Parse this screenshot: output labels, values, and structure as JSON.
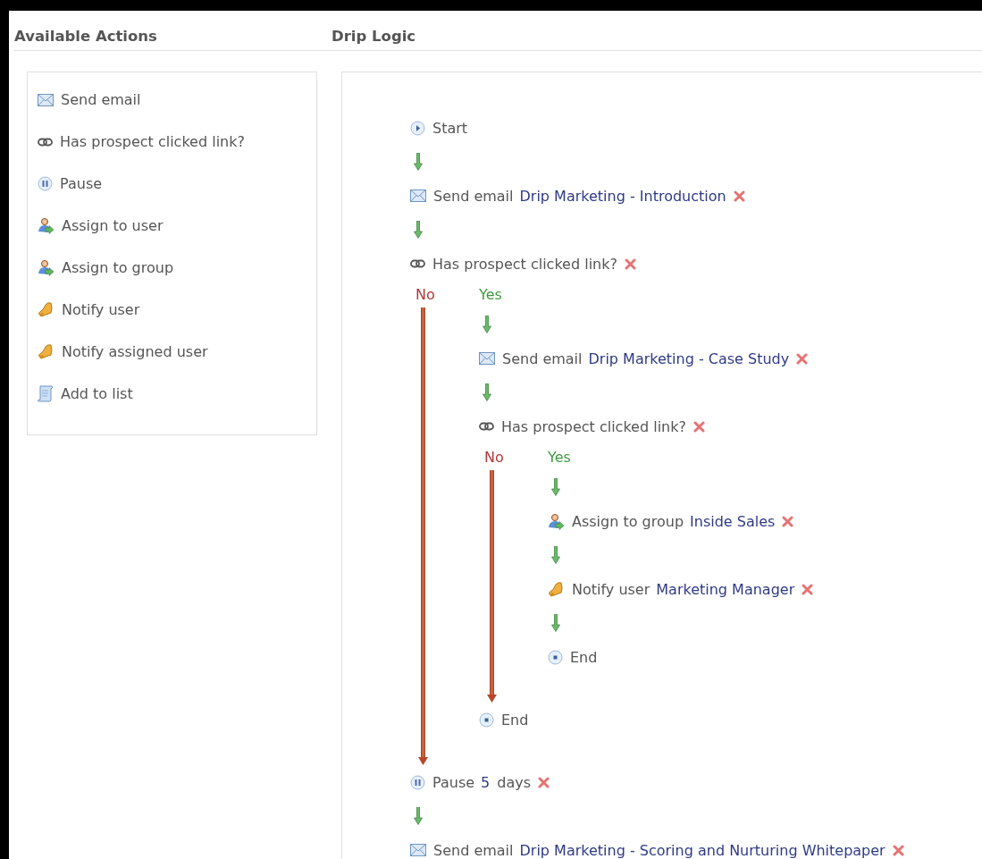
{
  "headers": {
    "actions": "Available Actions",
    "logic": "Drip Logic"
  },
  "actions": [
    {
      "kind": "email",
      "label": "Send email"
    },
    {
      "kind": "condition",
      "label": "Has prospect clicked link?"
    },
    {
      "kind": "pause",
      "label": "Pause"
    },
    {
      "kind": "assign",
      "label": "Assign to user"
    },
    {
      "kind": "assign",
      "label": "Assign to group"
    },
    {
      "kind": "notify",
      "label": "Notify user"
    },
    {
      "kind": "notify",
      "label": "Notify assigned user"
    },
    {
      "kind": "list",
      "label": "Add to list"
    }
  ],
  "flow": [
    {
      "kind": "start",
      "label": "Start"
    },
    {
      "kind": "email",
      "label": "Send email",
      "value": "Drip Marketing - Introduction"
    },
    {
      "kind": "condition",
      "label": "Has prospect clicked link?",
      "no_label": "No",
      "yes_label": "Yes",
      "yes": [
        {
          "kind": "email",
          "label": "Send email",
          "value": "Drip Marketing - Case Study"
        },
        {
          "kind": "condition",
          "label": "Has prospect clicked link?",
          "no_label": "No",
          "yes_label": "Yes",
          "yes": [
            {
              "kind": "assign",
              "label": "Assign to group",
              "value": "Inside Sales"
            },
            {
              "kind": "notify",
              "label": "Notify user",
              "value": "Marketing Manager"
            },
            {
              "kind": "end",
              "label": "End"
            }
          ]
        },
        {
          "kind": "end",
          "label": "End"
        }
      ]
    },
    {
      "kind": "pause",
      "label": "Pause",
      "value": "5",
      "suffix": "days"
    },
    {
      "kind": "email",
      "label": "Send email",
      "value": "Drip Marketing - Scoring and Nurturing Whitepaper"
    }
  ]
}
